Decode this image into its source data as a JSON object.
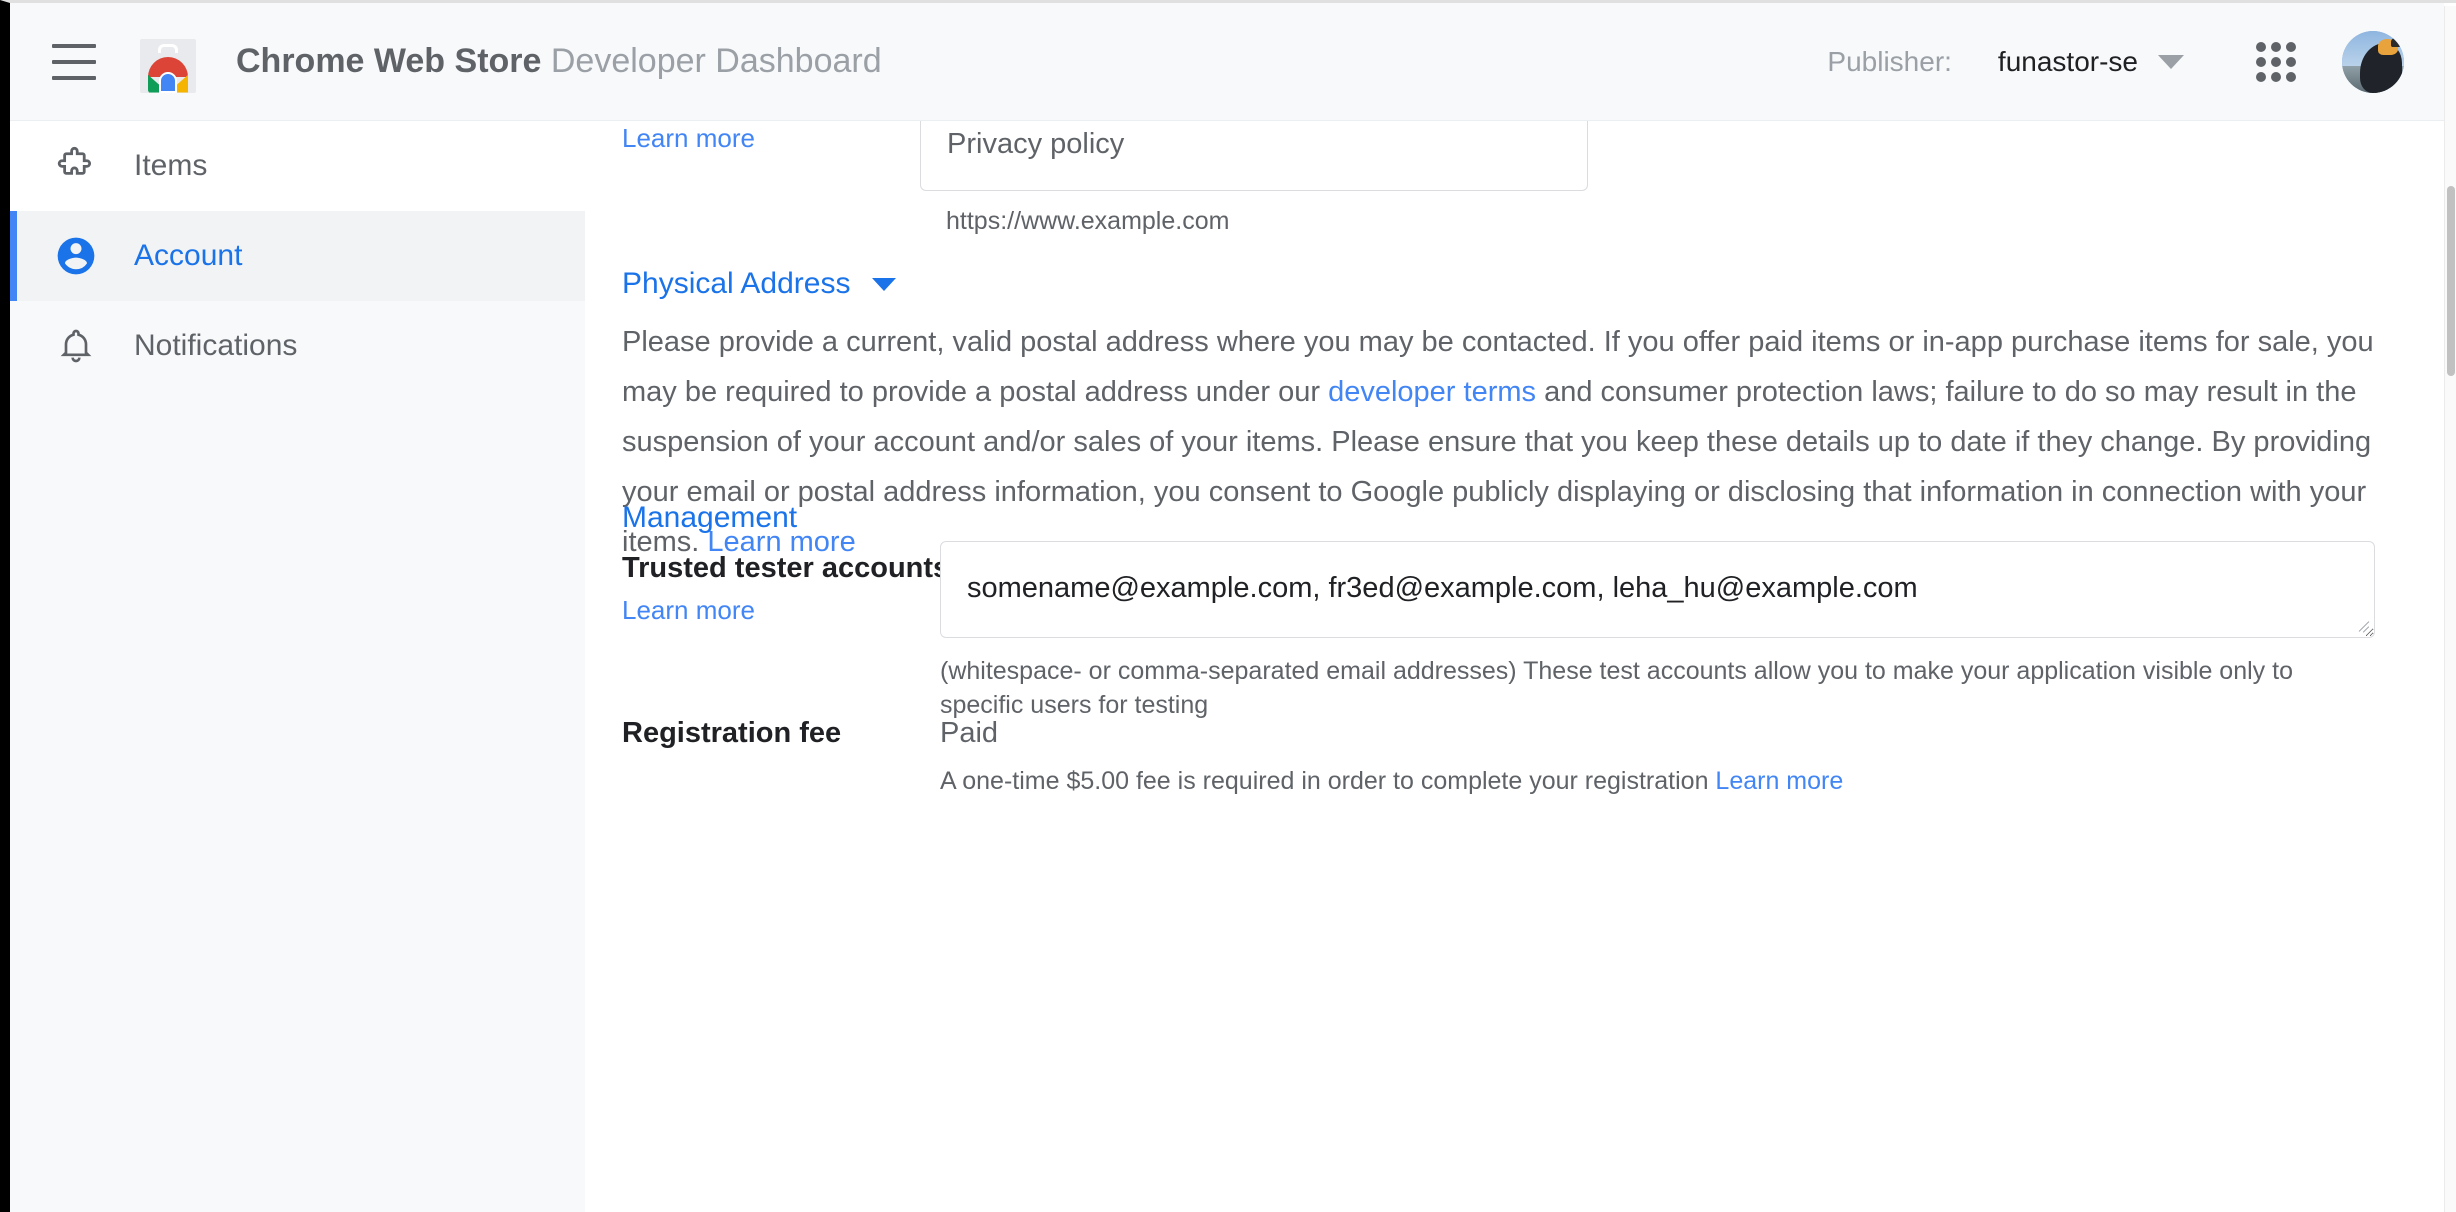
{
  "header": {
    "menu_icon": "hamburger-menu-icon",
    "logo_icon": "chrome-web-store-logo",
    "title_strong": "Chrome Web Store",
    "title_light": "Developer Dashboard",
    "publisher_label": "Publisher:",
    "publisher_value": "funastor-se",
    "publisher_caret_icon": "chevron-down-icon",
    "apps_icon": "apps-grid-icon",
    "avatar_icon": "user-avatar"
  },
  "sidebar": {
    "items": [
      {
        "label": "Items",
        "icon": "puzzle-piece-icon",
        "active": false
      },
      {
        "label": "Account",
        "icon": "account-circle-icon",
        "active": true
      },
      {
        "label": "Notifications",
        "icon": "bell-icon",
        "active": false
      }
    ]
  },
  "content": {
    "top_learn_more": "Learn more",
    "privacy_policy": {
      "value": "Privacy policy",
      "hint": "https://www.example.com"
    },
    "physical_address": {
      "heading": "Physical Address",
      "caret_icon": "chevron-down-icon",
      "paragraph_part1": "Please provide a current, valid postal address where you may be contacted. If you offer paid items or in-app purchase items for sale, you may be required to provide a postal address under our ",
      "paragraph_link1": "developer terms",
      "paragraph_part2": " and consumer protection laws; failure to do so may result in the suspension of your account and/or sales of your items. Please ensure that you keep these details up to date if they change. By providing your email or postal address information, you consent to Google publicly displaying or disclosing that information in connection with your items. ",
      "paragraph_link2": "Learn more"
    },
    "management": {
      "heading": "Management",
      "trusted_testers": {
        "label": "Trusted tester accounts",
        "learn_more": "Learn more",
        "value": "somename@example.com, fr3ed@example.com, leha_hu@example.com",
        "hint": "(whitespace- or comma-separated email addresses) These test accounts allow you to make your application visible only to specific users for testing"
      },
      "registration_fee": {
        "label": "Registration fee",
        "value": "Paid",
        "note_text": "A one-time $5.00 fee is required in order to complete your registration ",
        "note_link": "Learn more"
      }
    }
  },
  "colors": {
    "accent_blue": "#1a73e8",
    "link_blue": "#4285f4",
    "text_gray": "#5f6368",
    "text_dark": "#202124",
    "sidebar_bg": "#f8f9fa"
  }
}
